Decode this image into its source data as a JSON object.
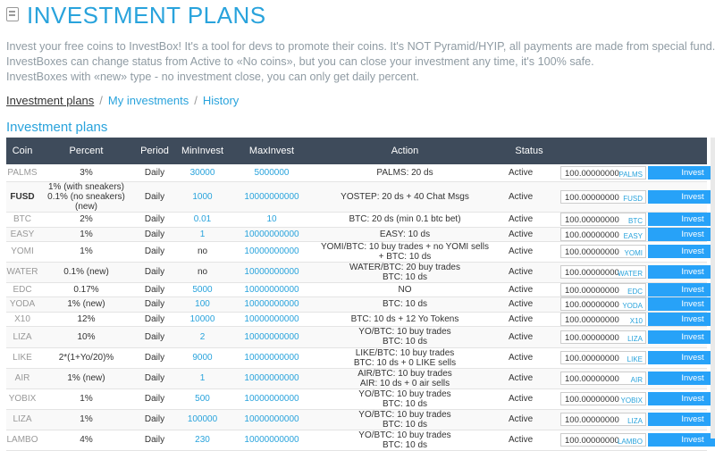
{
  "header": {
    "title": "INVESTMENT PLANS"
  },
  "description": [
    "Invest your free coins to InvestBox! It's a tool for devs to promote their coins. It's NOT Pyramid/HYIP, all payments are made from special fund.",
    "InvestBoxes can change status from Active to «No coins», but you can close your investment any time, it's 100% safe.",
    "InvestBoxes with «new» type - no investment close, you can only get daily percent."
  ],
  "tabs": [
    "Investment plans",
    "My investments",
    "History"
  ],
  "section_title": "Investment plans",
  "columns": [
    "Coin",
    "Percent",
    "Period",
    "MinInvest",
    "MaxInvest",
    "Action",
    "Status"
  ],
  "invest_label": "Invest",
  "rows": [
    {
      "coin": "PALMS",
      "bold": false,
      "percent": [
        "3%"
      ],
      "period": "Daily",
      "min": "30000",
      "min_link": true,
      "max": "5000000",
      "max_link": true,
      "action": [
        "PALMS: 20 ds"
      ],
      "status": "Active",
      "amount": "100.00000000",
      "code": "PALMS",
      "h": 19
    },
    {
      "coin": "FUSD",
      "bold": true,
      "percent": [
        "1% (with sneakers)",
        "0.1% (no sneakers)",
        "(new)"
      ],
      "period": "Daily",
      "min": "1000",
      "min_link": true,
      "max": "10000000000",
      "max_link": true,
      "action": [
        "YOSTEP: 20 ds + 40 Chat Msgs"
      ],
      "status": "Active",
      "amount": "100.00000000",
      "code": "FUSD",
      "h": 32
    },
    {
      "coin": "BTC",
      "bold": false,
      "percent": [
        "2%"
      ],
      "period": "Daily",
      "min": "0.01",
      "min_link": true,
      "max": "10",
      "max_link": true,
      "action": [
        "BTC: 20 ds (min 0.1 btc bet)"
      ],
      "status": "Active",
      "amount": "100.00000000",
      "code": "BTC",
      "h": 17
    },
    {
      "coin": "EASY",
      "bold": false,
      "percent": [
        "1%"
      ],
      "period": "Daily",
      "min": "1",
      "min_link": true,
      "max": "10000000000",
      "max_link": true,
      "action": [
        "EASY: 10 ds"
      ],
      "status": "Active",
      "amount": "100.00000000",
      "code": "EASY",
      "h": 16
    },
    {
      "coin": "YOMI",
      "bold": false,
      "percent": [
        "1%"
      ],
      "period": "Daily",
      "min": "no",
      "min_link": false,
      "max": "10000000000",
      "max_link": true,
      "action": [
        "YOMI/BTC: 10 buy trades + no YOMI sells",
        "+ BTC: 10 ds"
      ],
      "status": "Active",
      "amount": "100.00000000",
      "code": "YOMI",
      "h": 22
    },
    {
      "coin": "WATER",
      "bold": false,
      "percent": [
        "0.1% (new)"
      ],
      "period": "Daily",
      "min": "no",
      "min_link": false,
      "max": "10000000000",
      "max_link": true,
      "action": [
        "WATER/BTC: 20 buy trades",
        "BTC: 10 ds"
      ],
      "status": "Active",
      "amount": "100.00000000",
      "code": "WATER",
      "h": 23
    },
    {
      "coin": "EDC",
      "bold": false,
      "percent": [
        "0.17%"
      ],
      "period": "Daily",
      "min": "5000",
      "min_link": true,
      "max": "10000000000",
      "max_link": true,
      "action": [
        "NO"
      ],
      "status": "Active",
      "amount": "100.00000000",
      "code": "EDC",
      "h": 16
    },
    {
      "coin": "YODA",
      "bold": false,
      "percent": [
        "1% (new)"
      ],
      "period": "Daily",
      "min": "100",
      "min_link": true,
      "max": "10000000000",
      "max_link": true,
      "action": [
        "BTC: 10 ds"
      ],
      "status": "Active",
      "amount": "100.00000000",
      "code": "YODA",
      "h": 17
    },
    {
      "coin": "X10",
      "bold": false,
      "percent": [
        "12%"
      ],
      "period": "Daily",
      "min": "10000",
      "min_link": true,
      "max": "10000000000",
      "max_link": true,
      "action": [
        "BTC: 10 ds + 12 Yo Tokens"
      ],
      "status": "Active",
      "amount": "100.00000000",
      "code": "X10",
      "h": 16
    },
    {
      "coin": "LIZA",
      "bold": false,
      "percent": [
        "10%"
      ],
      "period": "Daily",
      "min": "2",
      "min_link": true,
      "max": "10000000000",
      "max_link": true,
      "action": [
        "YO/BTC: 10 buy trades",
        "BTC: 10 ds"
      ],
      "status": "Active",
      "amount": "100.00000000",
      "code": "LIZA",
      "h": 24
    },
    {
      "coin": "LIKE",
      "bold": false,
      "percent": [
        "2*(1+Yo/20)%"
      ],
      "period": "Daily",
      "min": "9000",
      "min_link": true,
      "max": "10000000000",
      "max_link": true,
      "action": [
        "LIKE/BTC: 10 buy trades",
        "BTC: 10 ds + 0 LIKE sells"
      ],
      "status": "Active",
      "amount": "100.00000000",
      "code": "LIKE",
      "h": 23
    },
    {
      "coin": "AIR",
      "bold": false,
      "percent": [
        "1% (new)"
      ],
      "period": "Daily",
      "min": "1",
      "min_link": true,
      "max": "10000000000",
      "max_link": true,
      "action": [
        "AIR/BTC: 10 buy trades",
        "AIR: 10 ds + 0 air sells"
      ],
      "status": "Active",
      "amount": "100.00000000",
      "code": "AIR",
      "h": 23
    },
    {
      "coin": "YOBIX",
      "bold": false,
      "percent": [
        "1%"
      ],
      "period": "Daily",
      "min": "500",
      "min_link": true,
      "max": "10000000000",
      "max_link": true,
      "action": [
        "YO/BTC: 10 buy trades",
        "BTC: 10 ds"
      ],
      "status": "Active",
      "amount": "100.00000000",
      "code": "YOBIX",
      "h": 22
    },
    {
      "coin": "LIZA",
      "bold": false,
      "percent": [
        "1%"
      ],
      "period": "Daily",
      "min": "100000",
      "min_link": true,
      "max": "10000000000",
      "max_link": true,
      "action": [
        "YO/BTC: 10 buy trades",
        "BTC: 10 ds"
      ],
      "status": "Active",
      "amount": "100.00000000",
      "code": "LIZA",
      "h": 22
    },
    {
      "coin": "LAMBO",
      "bold": false,
      "percent": [
        "4%"
      ],
      "period": "Daily",
      "min": "230",
      "min_link": true,
      "max": "10000000000",
      "max_link": true,
      "action": [
        "YO/BTC: 10 buy trades",
        "BTC: 10 ds"
      ],
      "status": "Active",
      "amount": "100.00000000",
      "code": "LAMBO",
      "h": 22
    }
  ]
}
